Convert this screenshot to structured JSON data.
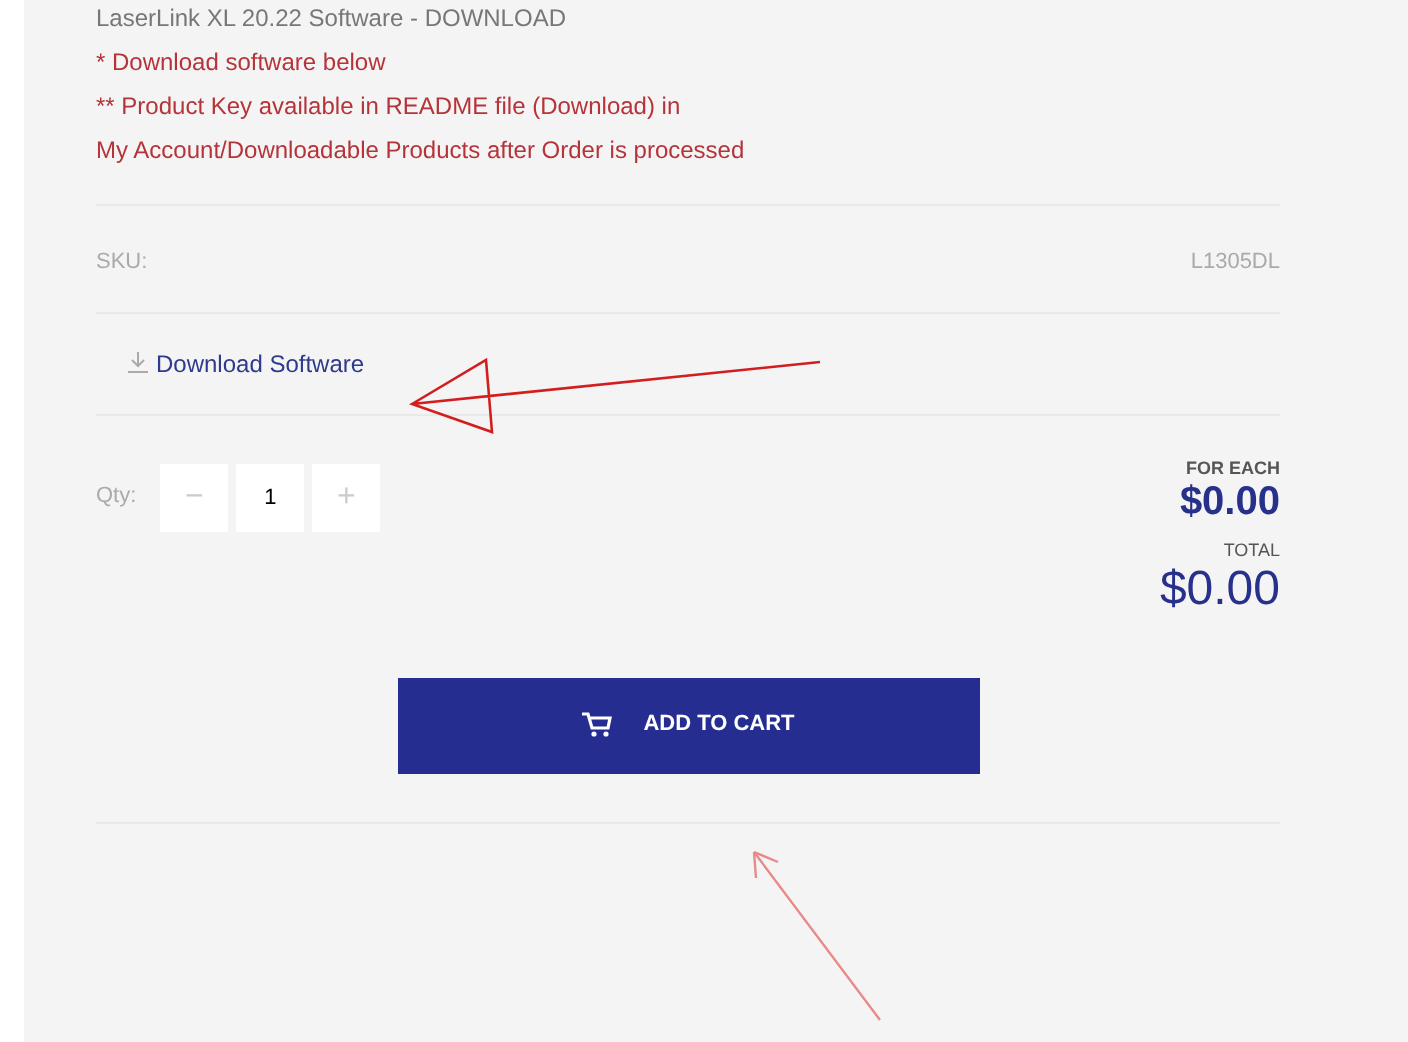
{
  "description": [
    {
      "kind": "title",
      "text": "LaserLink XL 20.22 Software - DOWNLOAD"
    },
    {
      "kind": "note",
      "text": "* Download software below"
    },
    {
      "kind": "note",
      "text": "** Product Key available in README file (Download) in"
    },
    {
      "kind": "note",
      "text": "My Account/Downloadable Products after Order is processed"
    }
  ],
  "sku": {
    "label": "SKU:",
    "value": "L1305DL"
  },
  "download_link": "Download Software",
  "quantity": {
    "label": "Qty:",
    "minus": "−",
    "value": "1",
    "plus": "+"
  },
  "price": {
    "each_label": "FOR EACH",
    "each_value": "$0.00",
    "total_label": "TOTAL",
    "total_value": "$0.00"
  },
  "add_to_cart": "ADD TO CART"
}
